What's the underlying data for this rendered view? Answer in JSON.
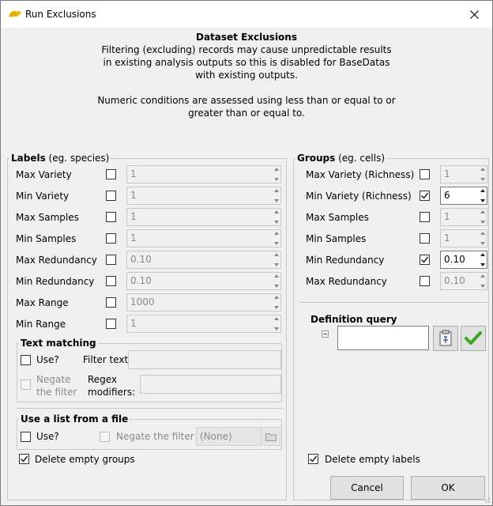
{
  "window": {
    "title": "Run Exclusions"
  },
  "header": {
    "title": "Dataset Exclusions",
    "line1": "Filtering (excluding) records may cause unpredictable results",
    "line2": "in existing analysis outputs so this is disabled for BaseDatas",
    "line3": "with existing outputs.",
    "line4": "Numeric conditions are assessed using less than or equal to or",
    "line5": "greater than or equal to."
  },
  "labels_panel": {
    "legend_bold": "Labels",
    "legend_rest": " (eg. species)",
    "rows": [
      {
        "label": "Max Variety",
        "checked": false,
        "value": "1"
      },
      {
        "label": "Min Variety",
        "checked": false,
        "value": "1"
      },
      {
        "label": "Max Samples",
        "checked": false,
        "value": "1"
      },
      {
        "label": "Min Samples",
        "checked": false,
        "value": "1"
      },
      {
        "label": "Max Redundancy",
        "checked": false,
        "value": "0.10"
      },
      {
        "label": "Min Redundancy",
        "checked": false,
        "value": "0.10"
      },
      {
        "label": "Max Range",
        "checked": false,
        "value": "1000"
      },
      {
        "label": "Min Range",
        "checked": false,
        "value": "1"
      }
    ],
    "text_matching": {
      "legend": "Text matching",
      "use_label": "Use?",
      "filter_text_label": "Filter text:",
      "filter_text_value": "",
      "negate_line1": "Negate",
      "negate_line2": "the filter",
      "regex_line1": "Regex",
      "regex_line2": "modifiers:",
      "regex_value": ""
    },
    "list_file": {
      "legend": "Use a list from a file",
      "use_label": "Use?",
      "negate_label": "Negate the filter",
      "file_value": "(None)"
    },
    "delete_empty_label": "Delete empty groups"
  },
  "groups_panel": {
    "legend_bold": "Groups",
    "legend_rest": " (eg. cells)",
    "rows": [
      {
        "label": "Max Variety (Richness)",
        "checked": false,
        "value": "1"
      },
      {
        "label": "Min Variety (Richness)",
        "checked": true,
        "value": "6"
      },
      {
        "label": "Max Samples",
        "checked": false,
        "value": "1"
      },
      {
        "label": "Min Samples",
        "checked": false,
        "value": "1"
      },
      {
        "label": "Min Redundancy",
        "checked": true,
        "value": "0.10"
      },
      {
        "label": "Max Redundancy",
        "checked": false,
        "value": "0.10"
      }
    ],
    "definition_query_label": "Definition query",
    "definition_query_value": "",
    "delete_empty_label": "Delete empty labels"
  },
  "buttons": {
    "cancel": "Cancel",
    "ok": "OK"
  }
}
